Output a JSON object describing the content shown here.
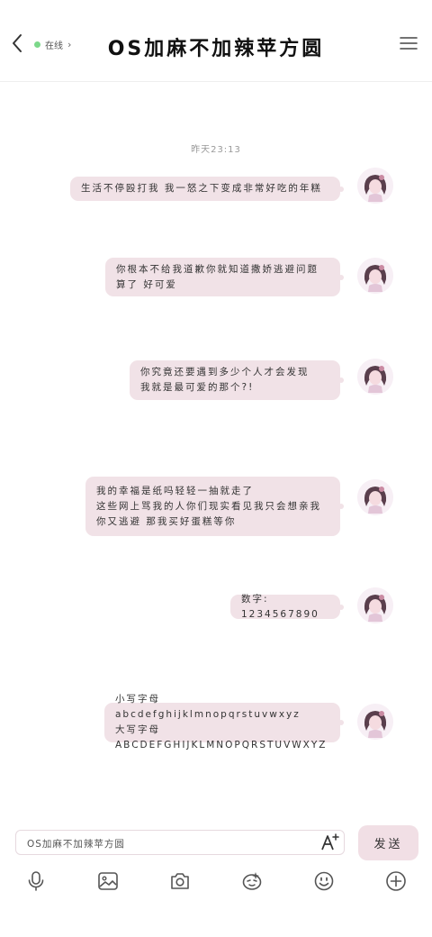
{
  "header": {
    "title": "OS加麻不加辣苹方圆",
    "status": "在线",
    "status_color": "#7cd88a"
  },
  "chat": {
    "timestamp": "昨天23:13",
    "messages": [
      {
        "text": "生活不停殴打我 我一怒之下变成非常好吃的年糕"
      },
      {
        "text": "你根本不给我道歉你就知道撒娇逃避问题\n算了 好可爱"
      },
      {
        "text": "你究竟还要遇到多少个人才会发现\n我就是最可爱的那个?!"
      },
      {
        "text": "我的幸福是纸吗轻轻一抽就走了\n这些网上骂我的人你们现实看见我只会想亲我\n你又逃避 那我买好蛋糕等你"
      },
      {
        "text": "数字: 1234567890"
      },
      {
        "text": "小写字母 abcdefghijklmnopqrstuvwxyz\n大写字母 ABCDEFGHIJKLMNOPQRSTUVWXYZ"
      }
    ],
    "bubble_color": "#f1e2e7"
  },
  "input": {
    "value": "OS加麻不加辣苹方圆",
    "send_label": "发送"
  },
  "toolbar": {
    "icons": [
      "microphone-icon",
      "image-icon",
      "camera-icon",
      "sticker-icon",
      "emoji-icon",
      "plus-icon"
    ]
  }
}
